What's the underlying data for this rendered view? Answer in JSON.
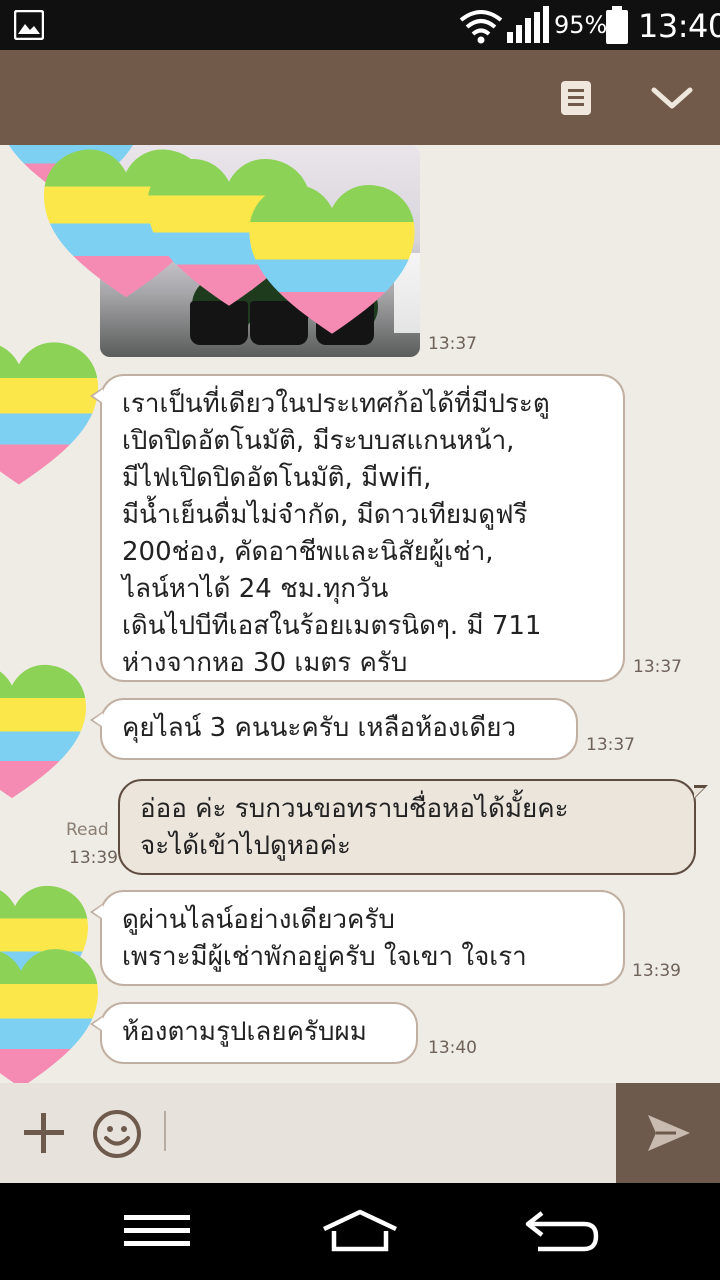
{
  "status_bar": {
    "battery_percent": "95%",
    "time": "13:40",
    "icons": [
      "gallery-icon",
      "wifi-icon",
      "signal-icon",
      "battery-icon"
    ]
  },
  "header": {
    "icons": [
      "notes-icon",
      "chevron-down-icon"
    ]
  },
  "messages": [
    {
      "type": "photo",
      "direction": "incoming",
      "time": "13:37"
    },
    {
      "type": "text",
      "direction": "incoming",
      "time": "13:37",
      "text": "เราเป็นที่เดียวในประเทศก้อได้ที่มีประตู\nเปิดปิดอัตโนมัติ, มีระบบสแกนหน้า,\nมีไฟเปิดปิดอัตโนมัติ, มีwifi,\nมีน้ำเย็นดื่มไม่จำกัด, มีดาวเทียมดูฟรี\n200ช่อง, คัดอาชีพและนิสัยผู้เช่า,\nไลน์หาได้ 24 ชม.ทุกวัน\nเดินไปบีทีเอสในร้อยเมตรนิดๆ. มี 711\nห่างจากหอ 30 เมตร ครับ"
    },
    {
      "type": "text",
      "direction": "incoming",
      "time": "13:37",
      "text": "คุยไลน์ 3 คนนะครับ เหลือห้องเดียว"
    },
    {
      "type": "text",
      "direction": "outgoing",
      "time": "13:39",
      "read_label": "Read",
      "text": "อ่ออ ค่ะ รบกวนขอทราบชื่อหอได้มั้ยคะ\nจะได้เข้าไปดูหอค่ะ"
    },
    {
      "type": "text",
      "direction": "incoming",
      "time": "13:39",
      "text": "ดูผ่านไลน์อย่างเดียวครับ\nเพราะมีผู้เช่าพักอยู่ครับ ใจเขา ใจเรา"
    },
    {
      "type": "text",
      "direction": "incoming",
      "time": "13:40",
      "text": "ห้องตามรูปเลยครับผม"
    }
  ],
  "input_bar": {
    "icons": [
      "plus-icon",
      "emoji-icon",
      "send-icon"
    ],
    "message_value": ""
  },
  "nav_bar": {
    "icons": [
      "menu-icon",
      "home-icon",
      "back-icon"
    ]
  },
  "colors": {
    "header": "#725a4b",
    "chat_background": "#efebe5",
    "incoming_bubble": "#ffffff",
    "outgoing_bubble": "#ece5dc",
    "send_button": "#6e5a4d"
  }
}
